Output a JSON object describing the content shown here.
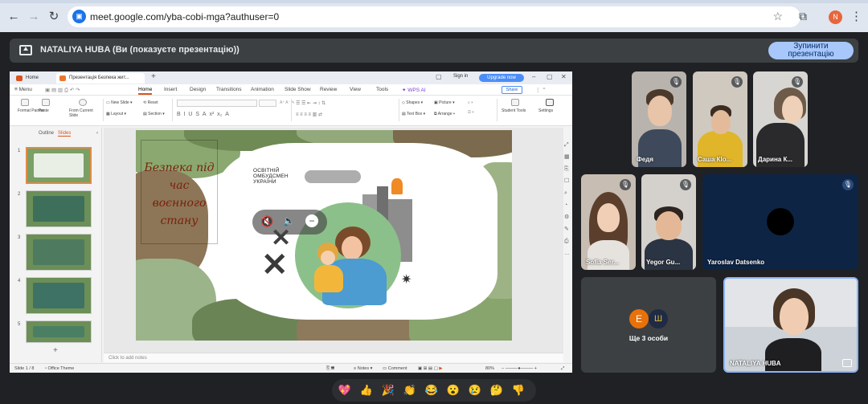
{
  "browser": {
    "url": "meet.google.com/yba-cobi-mga?authuser=0",
    "profile_initial": "N"
  },
  "presenting": {
    "text": "NATALIYA HUBA (Ви (показуєте презентацію))",
    "stop_label_line1": "Зупинити",
    "stop_label_line2": "презентацію"
  },
  "wps": {
    "tab_home": "Home",
    "tab_doc": "Презентація Безпека жит...",
    "sign_in": "Sign in",
    "upgrade": "Upgrade now",
    "menu": "≡ Menu",
    "menu_tabs": [
      "Home",
      "Insert",
      "Design",
      "Transitions",
      "Animation",
      "Slide Show",
      "Review",
      "View",
      "Tools",
      "WPS AI"
    ],
    "share": "Share",
    "ribbon": {
      "format_painter": "Format Painter",
      "paste": "Paste",
      "from_current_slide": "From Current Slide",
      "new_slide": "New Slide",
      "reset": "Reset",
      "layout": "Layout",
      "section": "Section",
      "shapes": "Shapes",
      "picture": "Picture",
      "text_box": "Text Box",
      "arrange": "Arrange",
      "student_tools": "Student Tools",
      "settings": "Settings"
    },
    "panel_tabs": {
      "outline": "Outline",
      "slides": "Slides"
    },
    "slide_numbers": [
      "1",
      "2",
      "3",
      "4",
      "5"
    ],
    "slide_title": "Безпека під час воєнного стану",
    "slide_org": "ОСВІТНІЙ ОМБУДСМЕН УКРАЇНИ",
    "notes_placeholder": "Click to add notes",
    "status": {
      "slide": "Slide 1 / 8",
      "theme": "Office Theme",
      "notes": "Notes",
      "comment": "Comment",
      "zoom": "80%"
    }
  },
  "participants": [
    {
      "name": "Федя",
      "muted": true
    },
    {
      "name": "Саша Кlo...",
      "muted": true
    },
    {
      "name": "Дарина К...",
      "muted": true
    },
    {
      "name": "Sofia Ser...",
      "muted": true
    },
    {
      "name": "Yegor Gu...",
      "muted": true
    },
    {
      "name": "Yaroslav Datsenko",
      "muted": true
    },
    {
      "name": "NATALIYA HUBA",
      "muted": false
    }
  ],
  "more_people": {
    "avatar_letter": "E",
    "label": "Ще 3 особи"
  },
  "reactions": [
    "💖",
    "👍",
    "🎉",
    "👏",
    "😂",
    "😮",
    "😢",
    "🤔",
    "👎"
  ],
  "colors": {
    "meet_bg": "#202124",
    "stop_button": "#a8c7fa",
    "wps_accent": "#d9531e",
    "slide_title": "#7a1f0a"
  }
}
